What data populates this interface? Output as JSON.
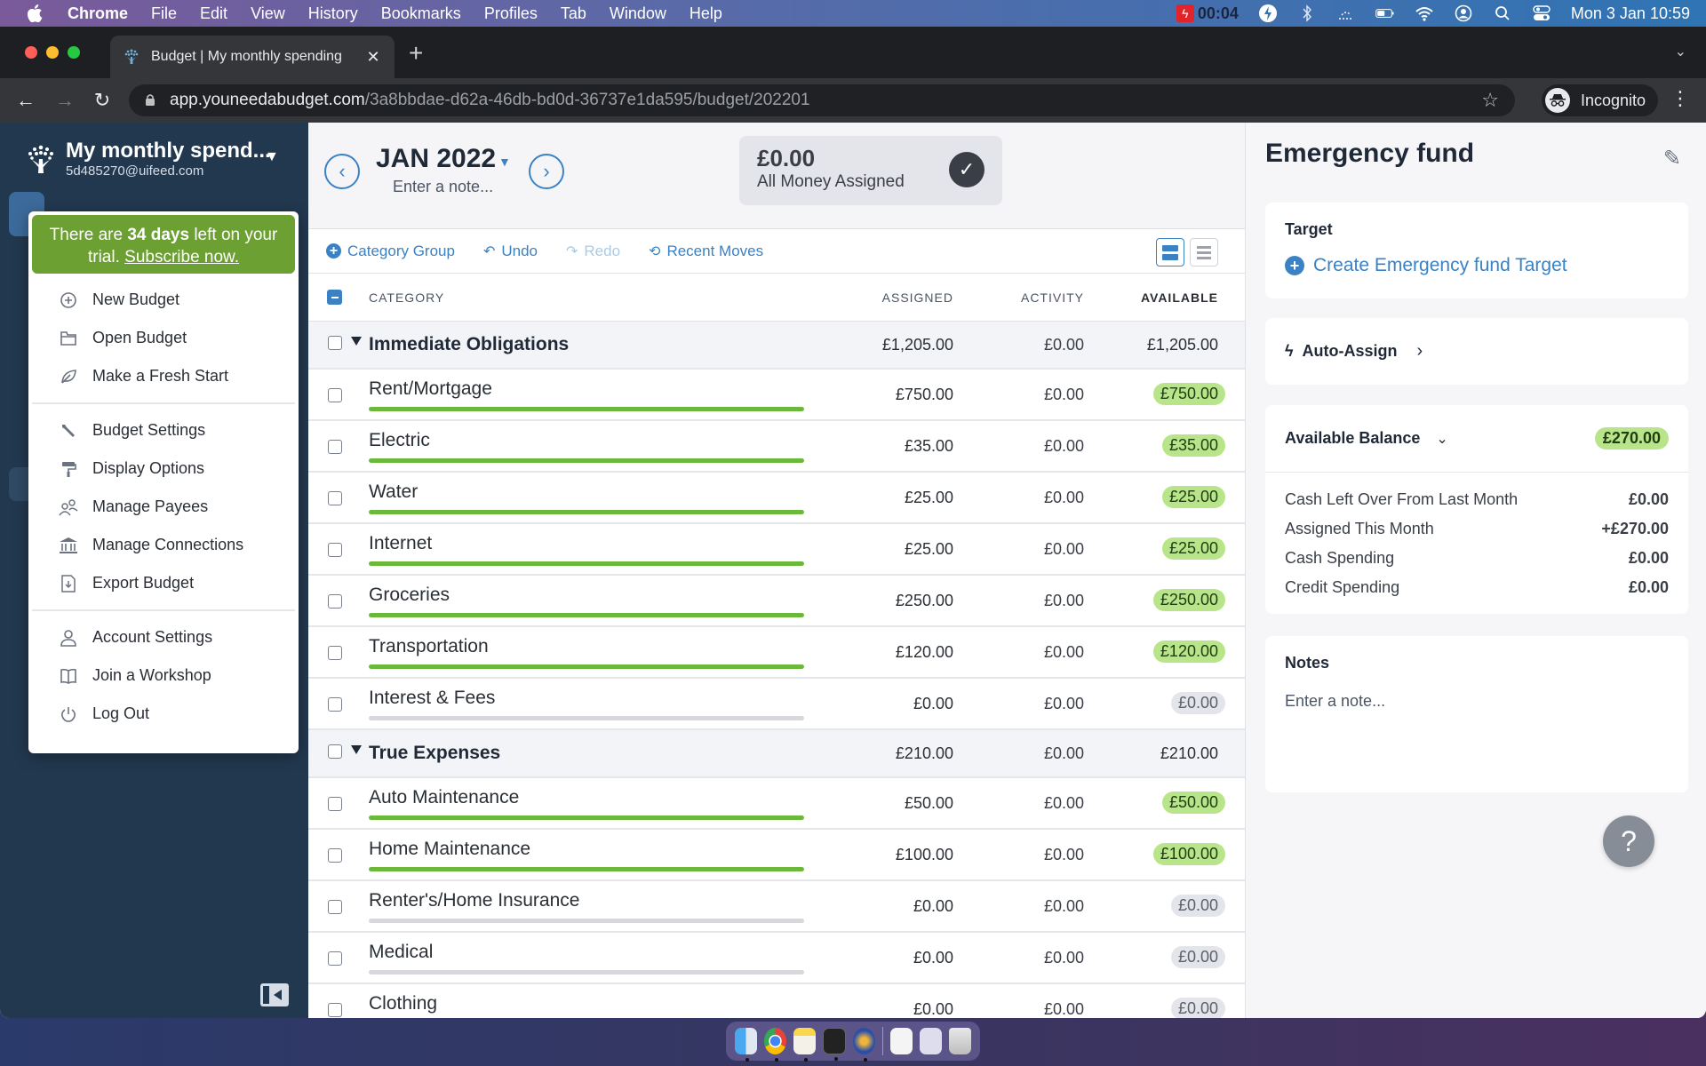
{
  "mac_menubar": {
    "app_name": "Chrome",
    "menus": [
      "File",
      "Edit",
      "View",
      "History",
      "Bookmarks",
      "Profiles",
      "Tab",
      "Window",
      "Help"
    ],
    "recording_time": "00:04",
    "datetime": "Mon 3 Jan  10:59"
  },
  "browser": {
    "tab_title": "Budget | My monthly spending",
    "url_host": "app.youneedabudget.com",
    "url_path": "/3a8bbdae-d62a-46db-bd0d-36737e1da595/budget/202201",
    "profile_label": "Incognito"
  },
  "sidebar": {
    "budget_name": "My monthly spend...",
    "email": "5d485270@uifeed.com"
  },
  "budget_menu": {
    "trial": {
      "prefix": "There are ",
      "days": "34 days",
      "suffix": " left on your trial. ",
      "link": "Subscribe now."
    },
    "sections": [
      [
        {
          "label": "New Budget",
          "icon": "plus-circle-icon"
        },
        {
          "label": "Open Budget",
          "icon": "folder-icon"
        },
        {
          "label": "Make a Fresh Start",
          "icon": "leaf-icon"
        }
      ],
      [
        {
          "label": "Budget Settings",
          "icon": "wrench-icon"
        },
        {
          "label": "Display Options",
          "icon": "paint-roller-icon"
        },
        {
          "label": "Manage Payees",
          "icon": "people-icon"
        },
        {
          "label": "Manage Connections",
          "icon": "bank-icon"
        },
        {
          "label": "Export Budget",
          "icon": "export-file-icon"
        }
      ],
      [
        {
          "label": "Account Settings",
          "icon": "user-icon"
        },
        {
          "label": "Join a Workshop",
          "icon": "book-icon"
        },
        {
          "label": "Log Out",
          "icon": "power-icon"
        }
      ]
    ]
  },
  "month": {
    "name": "JAN 2022",
    "note_placeholder": "Enter a note..."
  },
  "ready_to_assign": {
    "amount": "£0.00",
    "label": "All Money Assigned"
  },
  "toolbar": {
    "category_group": "Category Group",
    "undo": "Undo",
    "redo": "Redo",
    "recent_moves": "Recent Moves"
  },
  "columns": {
    "category": "CATEGORY",
    "assigned": "ASSIGNED",
    "activity": "ACTIVITY",
    "available": "AVAILABLE"
  },
  "rows": [
    {
      "type": "group",
      "name": "Immediate Obligations",
      "assigned": "£1,205.00",
      "activity": "£0.00",
      "available": "£1,205.00"
    },
    {
      "type": "cat",
      "name": "Rent/Mortgage",
      "assigned": "£750.00",
      "activity": "£0.00",
      "available": "£750.00",
      "status": "funded",
      "progress": 1
    },
    {
      "type": "cat",
      "name": "Electric",
      "assigned": "£35.00",
      "activity": "£0.00",
      "available": "£35.00",
      "status": "funded",
      "progress": 1
    },
    {
      "type": "cat",
      "name": "Water",
      "assigned": "£25.00",
      "activity": "£0.00",
      "available": "£25.00",
      "status": "funded",
      "progress": 1
    },
    {
      "type": "cat",
      "name": "Internet",
      "assigned": "£25.00",
      "activity": "£0.00",
      "available": "£25.00",
      "status": "funded",
      "progress": 1
    },
    {
      "type": "cat",
      "name": "Groceries",
      "assigned": "£250.00",
      "activity": "£0.00",
      "available": "£250.00",
      "status": "funded",
      "progress": 1
    },
    {
      "type": "cat",
      "name": "Transportation",
      "assigned": "£120.00",
      "activity": "£0.00",
      "available": "£120.00",
      "status": "funded",
      "progress": 1
    },
    {
      "type": "cat",
      "name": "Interest & Fees",
      "assigned": "£0.00",
      "activity": "£0.00",
      "available": "£0.00",
      "status": "zero",
      "progress": 0
    },
    {
      "type": "group",
      "name": "True Expenses",
      "assigned": "£210.00",
      "activity": "£0.00",
      "available": "£210.00"
    },
    {
      "type": "cat",
      "name": "Auto Maintenance",
      "assigned": "£50.00",
      "activity": "£0.00",
      "available": "£50.00",
      "status": "funded",
      "progress": 1
    },
    {
      "type": "cat",
      "name": "Home Maintenance",
      "assigned": "£100.00",
      "activity": "£0.00",
      "available": "£100.00",
      "status": "funded",
      "progress": 1
    },
    {
      "type": "cat",
      "name": "Renter's/Home Insurance",
      "assigned": "£0.00",
      "activity": "£0.00",
      "available": "£0.00",
      "status": "zero",
      "progress": 0
    },
    {
      "type": "cat",
      "name": "Medical",
      "assigned": "£0.00",
      "activity": "£0.00",
      "available": "£0.00",
      "status": "zero",
      "progress": 0
    },
    {
      "type": "cat",
      "name": "Clothing",
      "assigned": "£0.00",
      "activity": "£0.00",
      "available": "£0.00",
      "status": "zero",
      "progress": 0
    }
  ],
  "inspector": {
    "title": "Emergency fund",
    "target_label": "Target",
    "create_target": "Create Emergency fund Target",
    "auto_assign": "Auto-Assign",
    "available_balance_label": "Available Balance",
    "available_balance": "£270.00",
    "breakdown": [
      {
        "label": "Cash Left Over From Last Month",
        "value": "£0.00"
      },
      {
        "label": "Assigned This Month",
        "value": "+£270.00"
      },
      {
        "label": "Cash Spending",
        "value": "£0.00"
      },
      {
        "label": "Credit Spending",
        "value": "£0.00"
      }
    ],
    "notes_label": "Notes",
    "notes_placeholder": "Enter a note...",
    "help": "?"
  },
  "colors": {
    "sidebar_bg": "#22384f",
    "accent_blue": "#3b82c4",
    "trial_green": "#6ca032",
    "funded_pill": "#b9e58a",
    "progress_green": "#6bb83a"
  }
}
